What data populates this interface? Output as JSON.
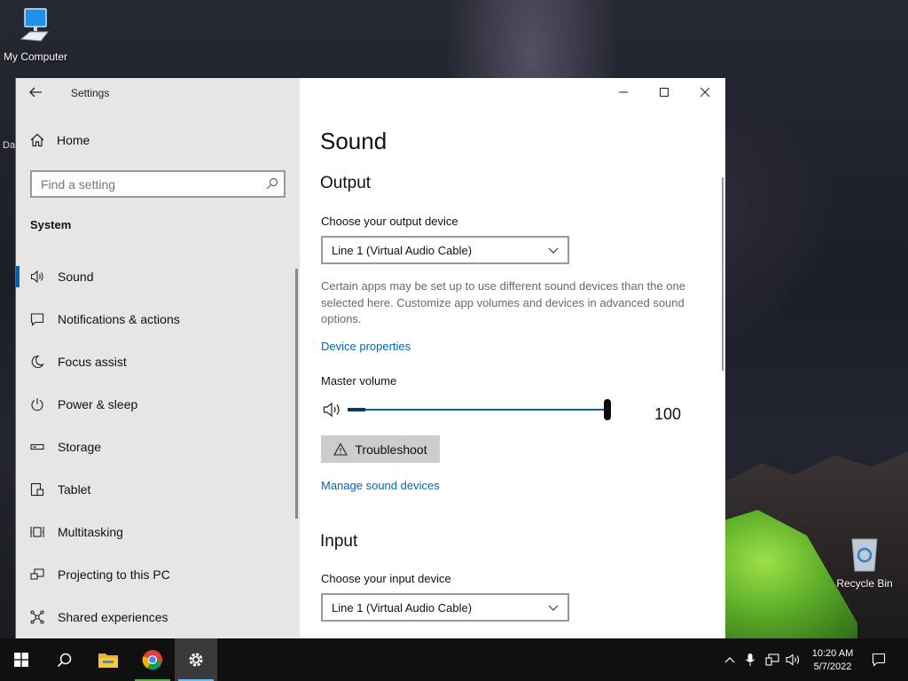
{
  "desktop": {
    "icons": {
      "my_computer": "My Computer",
      "recycle_bin": "Recycle Bin"
    },
    "partial_label": "Da"
  },
  "window": {
    "app_title": "Settings",
    "home_label": "Home",
    "search_placeholder": "Find a setting",
    "section": "System",
    "nav": [
      {
        "label": "Sound",
        "icon": "speaker-icon",
        "active": true
      },
      {
        "label": "Notifications & actions",
        "icon": "message-icon"
      },
      {
        "label": "Focus assist",
        "icon": "moon-icon"
      },
      {
        "label": "Power & sleep",
        "icon": "power-icon"
      },
      {
        "label": "Storage",
        "icon": "storage-icon"
      },
      {
        "label": "Tablet",
        "icon": "tablet-icon"
      },
      {
        "label": "Multitasking",
        "icon": "multitasking-icon"
      },
      {
        "label": "Projecting to this PC",
        "icon": "projecting-icon"
      },
      {
        "label": "Shared experiences",
        "icon": "shared-icon"
      }
    ]
  },
  "main": {
    "title": "Sound",
    "output": {
      "heading": "Output",
      "device_label": "Choose your output device",
      "device_value": "Line 1 (Virtual Audio Cable)",
      "description": "Certain apps may be set up to use different sound devices than the one selected here. Customize app volumes and devices in advanced sound options.",
      "device_properties_link": "Device properties",
      "master_volume_label": "Master volume",
      "volume_value": "100",
      "volume_level": 1.0,
      "troubleshoot_label": "Troubleshoot",
      "manage_link": "Manage sound devices"
    },
    "input": {
      "heading": "Input",
      "device_label": "Choose your input device",
      "device_value": "Line 1 (Virtual Audio Cable)"
    }
  },
  "taskbar": {
    "time": "10:20 AM",
    "date": "5/7/2022"
  },
  "colors": {
    "accent": "#0063b1",
    "link": "#0067b8",
    "sidebar_bg": "#e6e6e6"
  }
}
